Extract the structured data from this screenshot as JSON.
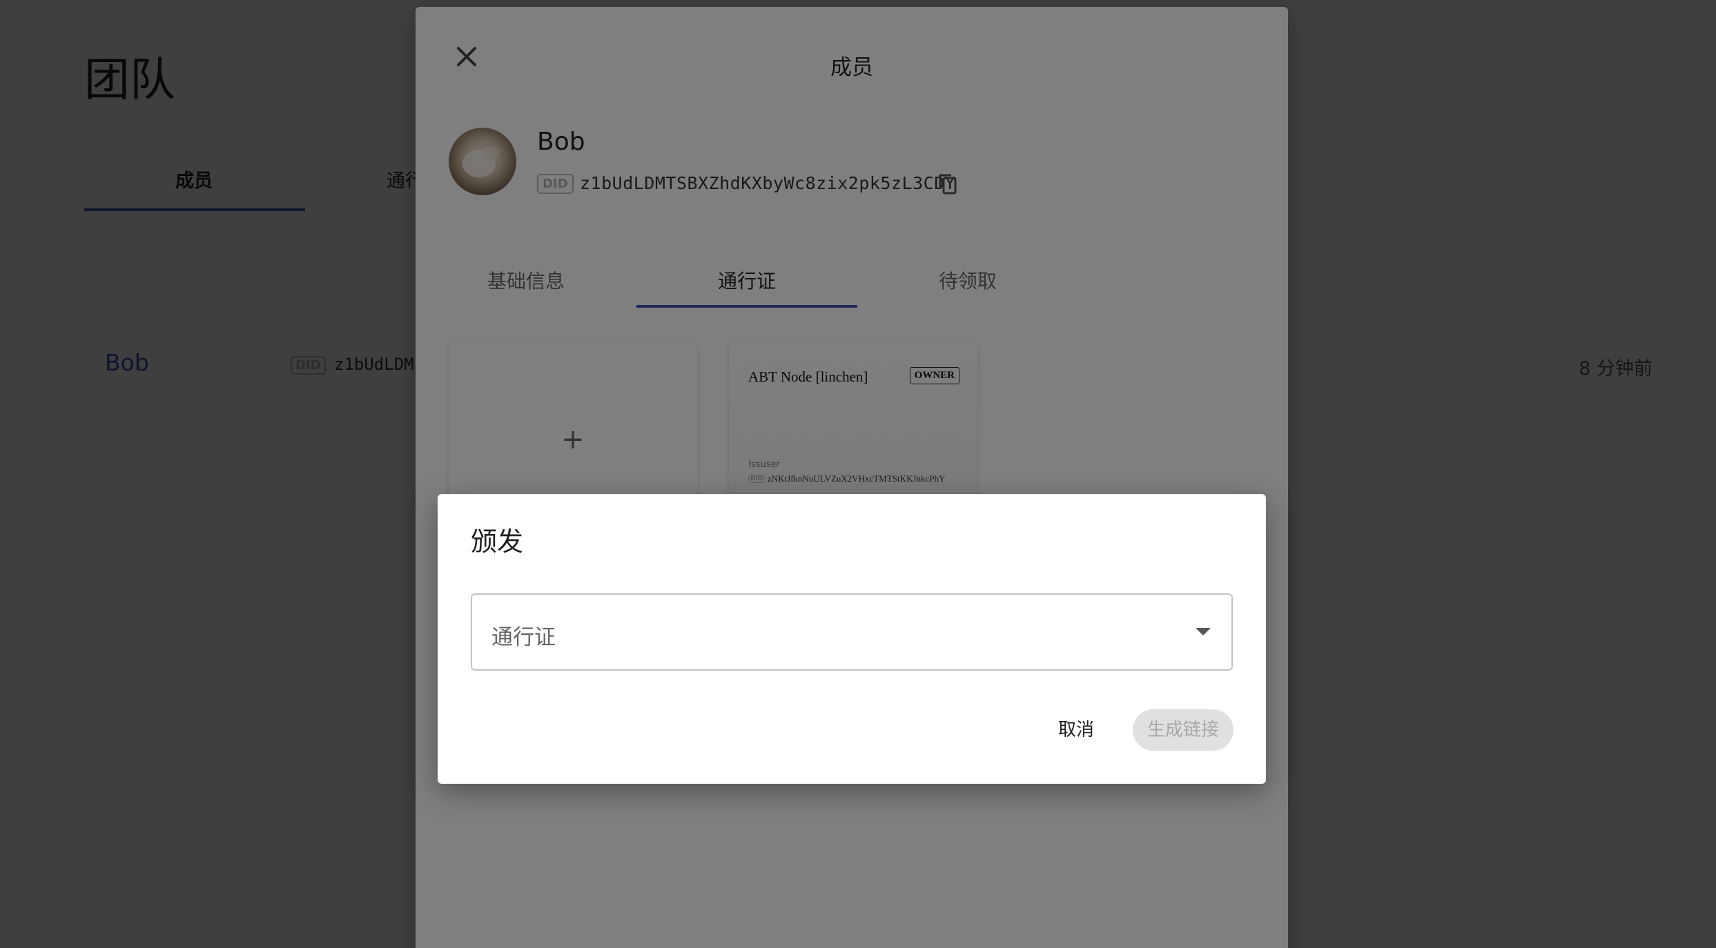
{
  "page": {
    "title": "团队",
    "tabs": [
      {
        "label": "成员"
      },
      {
        "label": "通行"
      }
    ],
    "members": [
      {
        "name": "Bob",
        "did_badge": "DID",
        "did": "z1bUdLDM",
        "time": "8 分钟前"
      }
    ]
  },
  "member_modal": {
    "title": "成员",
    "name": "Bob",
    "did_badge": "DID",
    "did": "z1bUdLDMTSBXZhdKXbyWc8zix2pk5zL3CDY",
    "tabs": [
      {
        "label": "基础信息"
      },
      {
        "label": "通行证"
      },
      {
        "label": "待领取"
      }
    ],
    "active_tab": "通行证",
    "add_card_symbol": "+",
    "passports": [
      {
        "title": "ABT Node [linchen]",
        "role": "OWNER",
        "issuer_label": "Issuser",
        "issuer_did_badge": "DID",
        "issuer_did": "zNKtJfknNuULVZuX2VHxcTMTStKKJnkcPhY"
      }
    ]
  },
  "issue_dialog": {
    "title": "颁发",
    "select_placeholder": "通行证",
    "cancel_label": "取消",
    "generate_label": "生成链接"
  },
  "colors": {
    "accent": "#3f51b5",
    "backdrop": "rgba(0,0,0,0.5)",
    "disabled_button_bg": "#e0e0e0"
  },
  "icons": {
    "close": "close-icon",
    "copy": "copy-icon",
    "dropdown": "caret-down-icon"
  }
}
